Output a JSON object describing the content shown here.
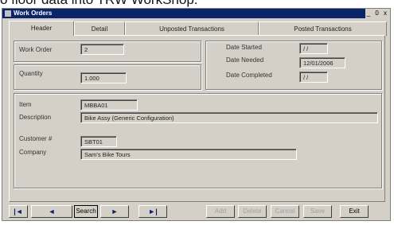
{
  "caption": "o floor data into TRW WorkShop.",
  "window": {
    "title": "Work Orders",
    "controls": "_ 0 x"
  },
  "tabs": [
    {
      "label": "Header"
    },
    {
      "label": "Detail"
    },
    {
      "label": "Unposted Transactions"
    },
    {
      "label": "Posted Transactions"
    }
  ],
  "header": {
    "work_order_label": "Work Order",
    "work_order_value": "2",
    "quantity_label": "Quantity",
    "quantity_value": "1.000",
    "date_started_label": "Date Started",
    "date_started_value": "/ /",
    "date_needed_label": "Date Needed",
    "date_needed_value": "12/01/2006",
    "date_completed_label": "Date Completed",
    "date_completed_value": "/ /",
    "item_label": "Item",
    "item_value": "MBBA01",
    "description_label": "Description",
    "description_value": "Bike Assy (Generic Configuration)",
    "customer_label": "Customer #",
    "customer_value": "SBT01",
    "company_label": "Company",
    "company_value": "Sam's Bike Tours"
  },
  "toolbar": {
    "first": "|◄",
    "prev": "◄",
    "search": "Search",
    "next": "►",
    "last": "►|",
    "add": "Add",
    "delete": "Delete",
    "cancel": "Cancel",
    "save": "Save",
    "exit": "Exit"
  }
}
